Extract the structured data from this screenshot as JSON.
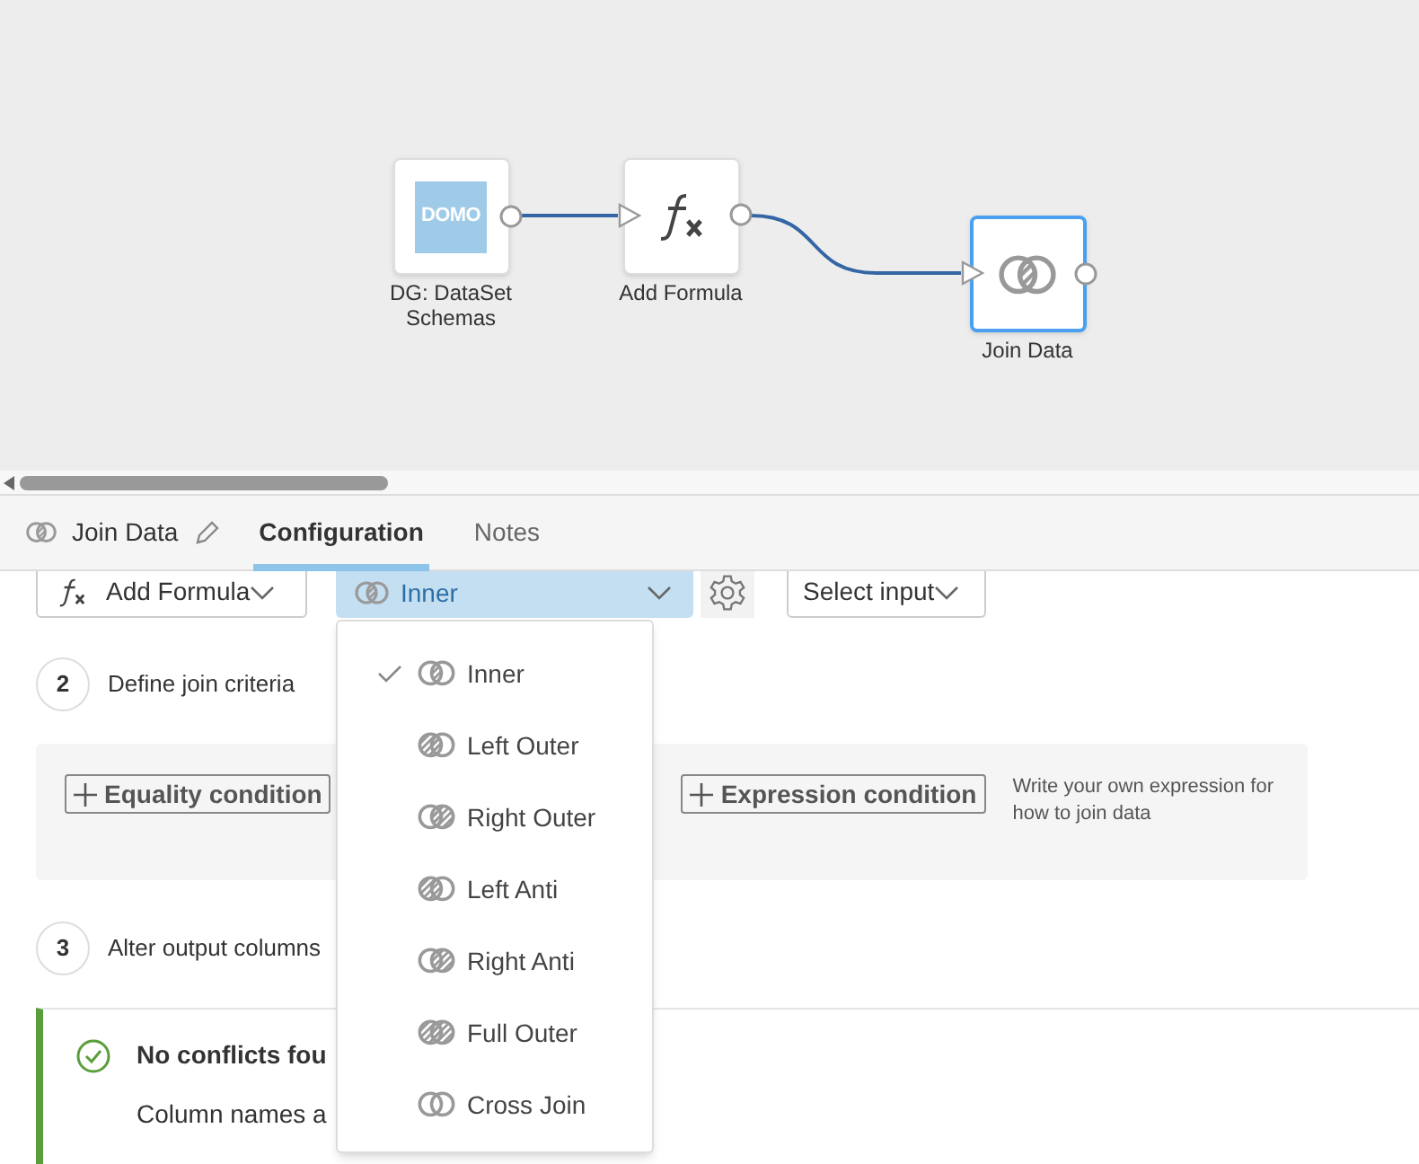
{
  "canvas": {
    "nodes": [
      {
        "kind": "dataset",
        "label": "DG: DataSet Schemas",
        "logo_text": "DOMO",
        "selected": false
      },
      {
        "kind": "formula",
        "label": "Add Formula",
        "selected": false
      },
      {
        "kind": "join",
        "label": "Join Data",
        "selected": true
      }
    ]
  },
  "panel": {
    "title": "Join Data",
    "tabs": [
      {
        "label": "Configuration",
        "selected": true
      },
      {
        "label": "Notes",
        "selected": false
      }
    ]
  },
  "inputs": {
    "left": "Add Formula",
    "join_type": "Inner",
    "right": "Select input"
  },
  "steps": [
    {
      "number": "2",
      "label": "Define join criteria"
    },
    {
      "number": "3",
      "label": "Alter output columns"
    }
  ],
  "criteria": {
    "equality": "Equality condition",
    "expression": "Expression condition",
    "hint": "Write your own expression for how to join data"
  },
  "status": {
    "title": "No conflicts fou",
    "message": "Column names a"
  },
  "join_menu": [
    {
      "kind": "inner",
      "label": "Inner",
      "selected": true
    },
    {
      "kind": "left_outer",
      "label": "Left Outer",
      "selected": false
    },
    {
      "kind": "right_outer",
      "label": "Right Outer",
      "selected": false
    },
    {
      "kind": "left_anti",
      "label": "Left Anti",
      "selected": false
    },
    {
      "kind": "right_anti",
      "label": "Right Anti",
      "selected": false
    },
    {
      "kind": "full_outer",
      "label": "Full Outer",
      "selected": false
    },
    {
      "kind": "cross",
      "label": "Cross Join",
      "selected": false
    }
  ]
}
